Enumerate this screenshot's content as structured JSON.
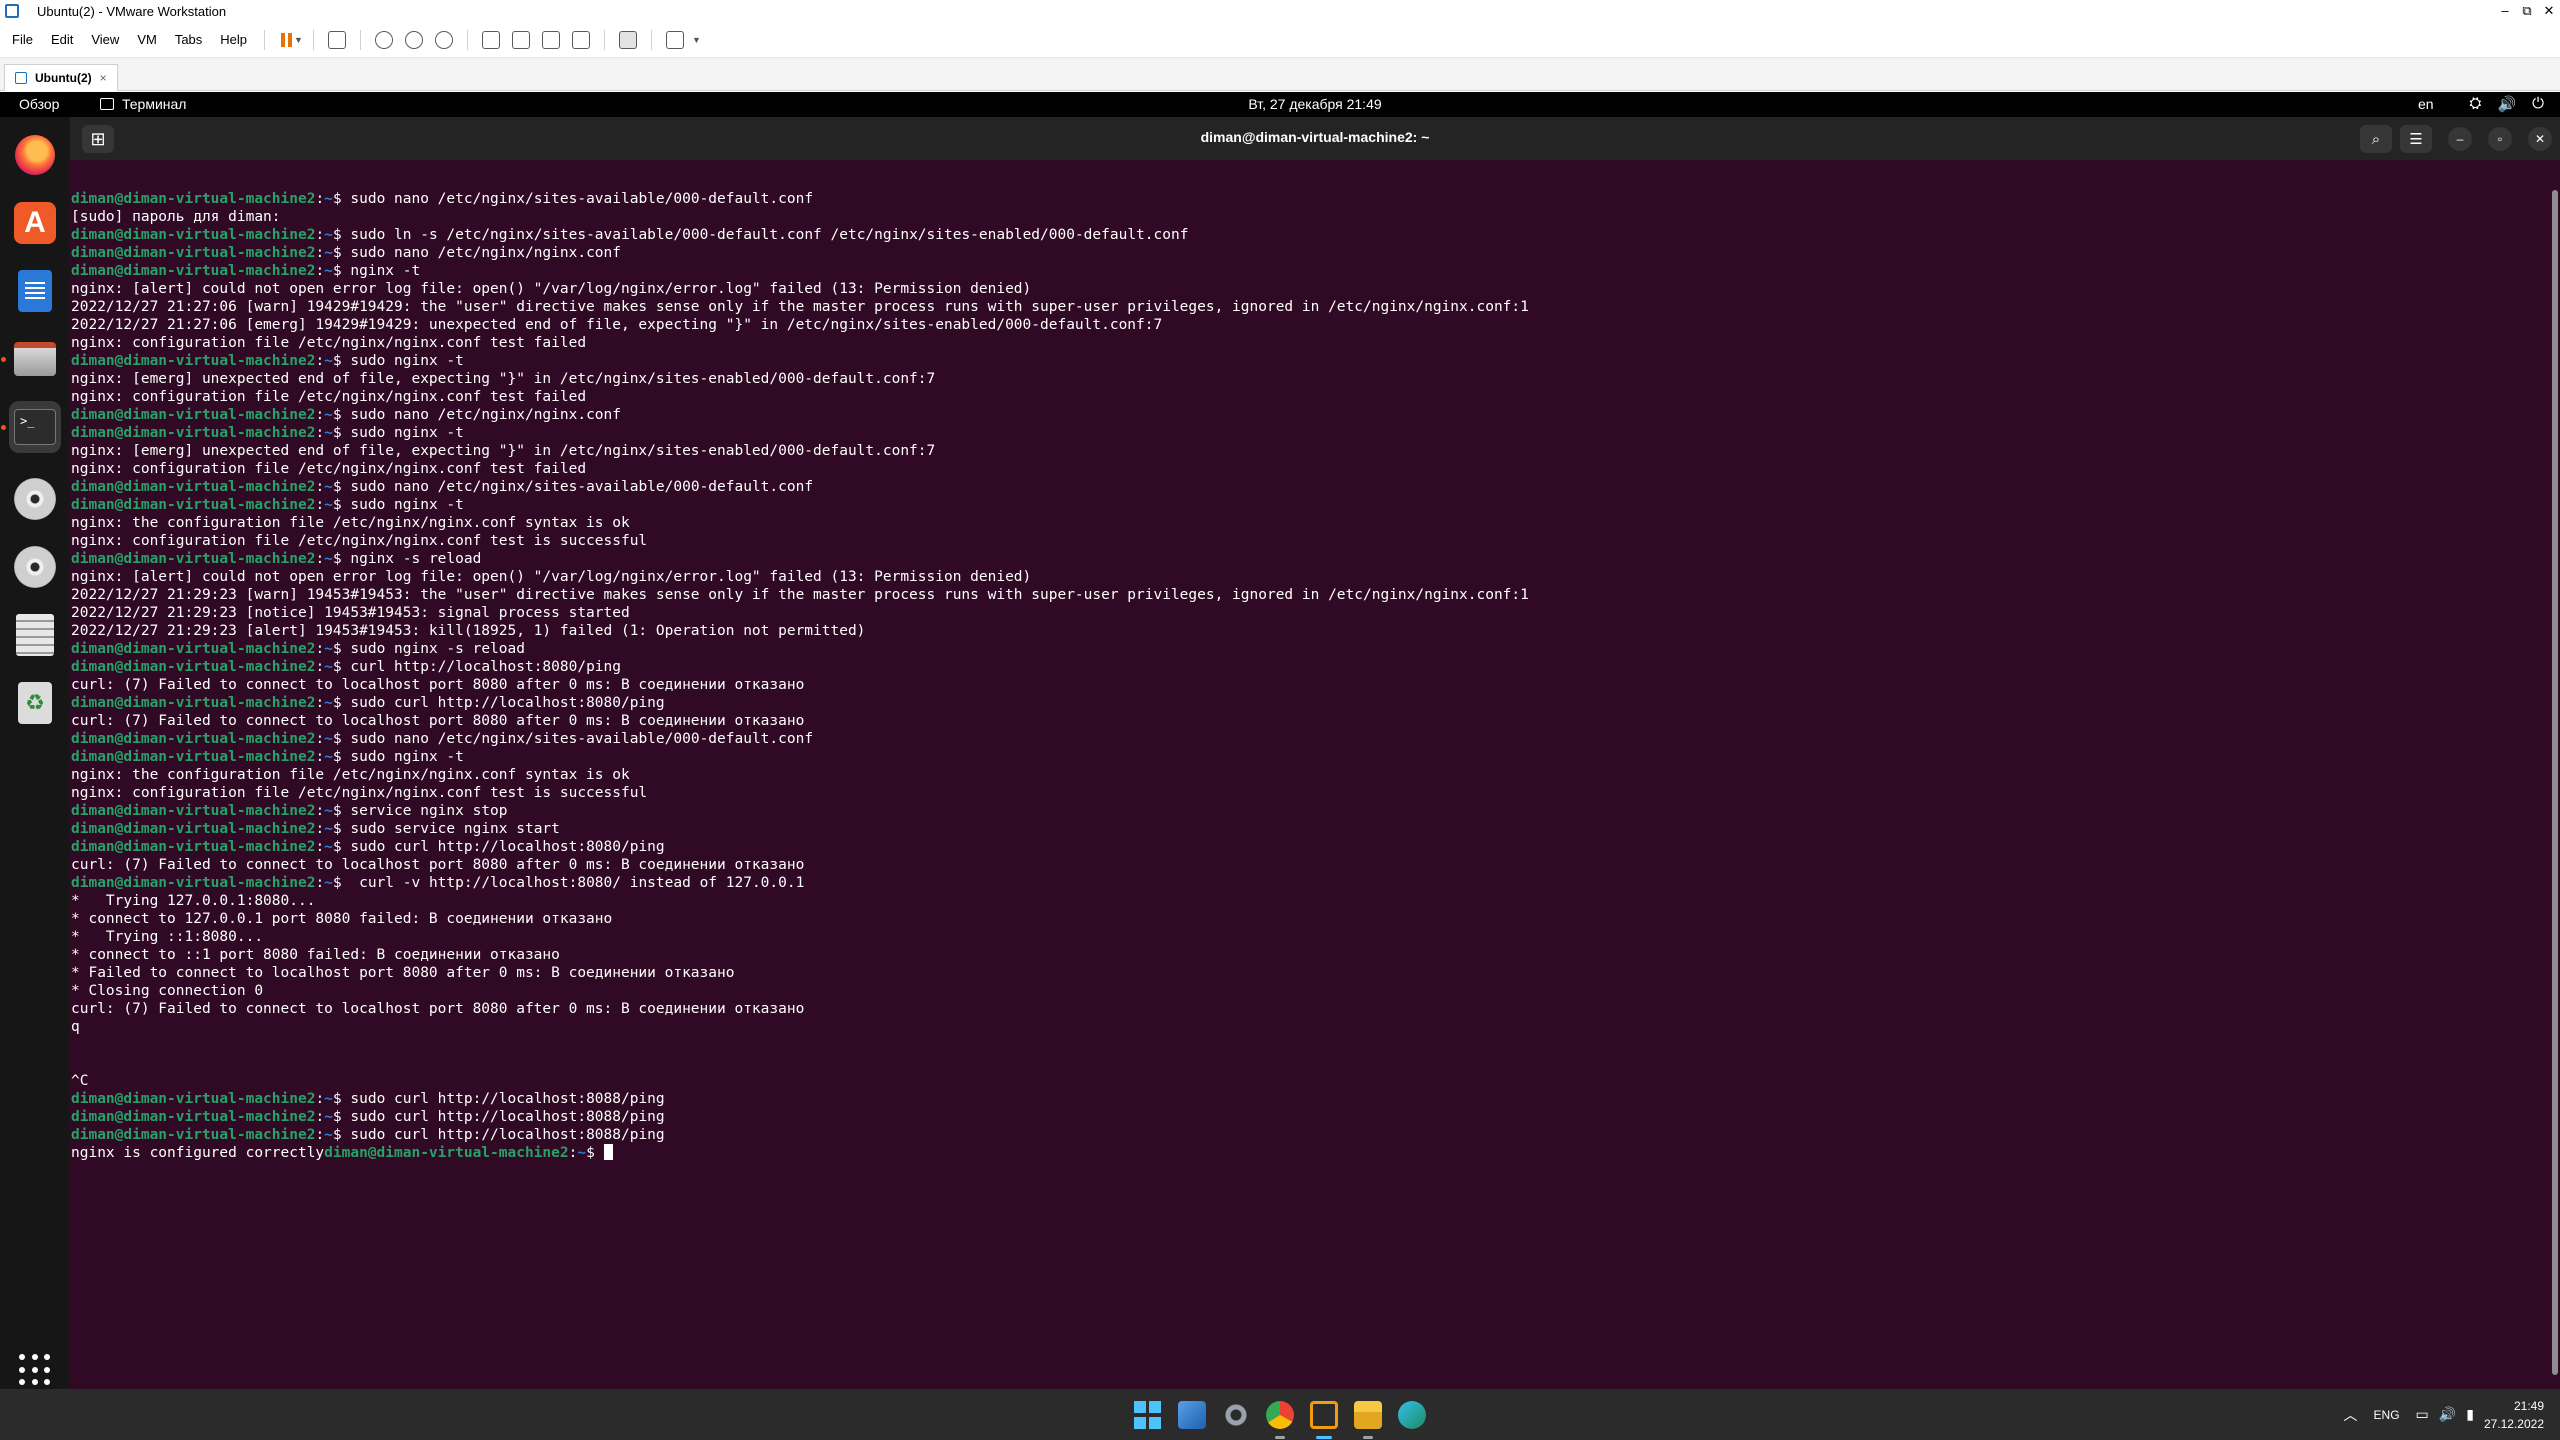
{
  "vmware": {
    "title": "Ubuntu(2) - VMware Workstation",
    "menu": [
      "File",
      "Edit",
      "View",
      "VM",
      "Tabs",
      "Help"
    ],
    "window_controls": [
      "–",
      "⧉",
      "✕"
    ],
    "tab": {
      "label": "Ubuntu(2)",
      "close": "×"
    }
  },
  "gnome": {
    "activities": "Обзор",
    "app_name": "Терминал",
    "clock": "Вт, 27 декабря  21:49",
    "lang": "en",
    "tray_icons": [
      "network-icon",
      "volume-icon",
      "power-icon"
    ]
  },
  "dock": {
    "items": [
      {
        "name": "firefox-icon"
      },
      {
        "name": "app-center-icon",
        "glyph": "A"
      },
      {
        "name": "libreoffice-writer-icon"
      },
      {
        "name": "files-icon"
      },
      {
        "name": "terminal-icon",
        "glyph": ">_",
        "active": true
      },
      {
        "name": "optical-disc-icon"
      },
      {
        "name": "optical-disc-icon"
      },
      {
        "name": "floppy-drive-icon"
      },
      {
        "name": "trash-icon",
        "glyph": "♻"
      }
    ]
  },
  "terminal": {
    "title": "diman@diman-virtual-machine2: ~",
    "prompt_user": "diman@diman-virtual-machine2",
    "prompt_path": "~",
    "lines": [
      {
        "p": true,
        "t": "sudo nano /etc/nginx/sites-available/000-default.conf"
      },
      {
        "t": "[sudo] пароль для diman:"
      },
      {
        "p": true,
        "t": "sudo ln -s /etc/nginx/sites-available/000-default.conf /etc/nginx/sites-enabled/000-default.conf"
      },
      {
        "p": true,
        "t": "sudo nano /etc/nginx/nginx.conf"
      },
      {
        "p": true,
        "t": "nginx -t"
      },
      {
        "t": "nginx: [alert] could not open error log file: open() \"/var/log/nginx/error.log\" failed (13: Permission denied)"
      },
      {
        "t": "2022/12/27 21:27:06 [warn] 19429#19429: the \"user\" directive makes sense only if the master process runs with super-user privileges, ignored in /etc/nginx/nginx.conf:1"
      },
      {
        "t": "2022/12/27 21:27:06 [emerg] 19429#19429: unexpected end of file, expecting \"}\" in /etc/nginx/sites-enabled/000-default.conf:7"
      },
      {
        "t": "nginx: configuration file /etc/nginx/nginx.conf test failed"
      },
      {
        "p": true,
        "t": "sudo nginx -t"
      },
      {
        "t": "nginx: [emerg] unexpected end of file, expecting \"}\" in /etc/nginx/sites-enabled/000-default.conf:7"
      },
      {
        "t": "nginx: configuration file /etc/nginx/nginx.conf test failed"
      },
      {
        "p": true,
        "t": "sudo nano /etc/nginx/nginx.conf"
      },
      {
        "p": true,
        "t": "sudo nginx -t"
      },
      {
        "t": "nginx: [emerg] unexpected end of file, expecting \"}\" in /etc/nginx/sites-enabled/000-default.conf:7"
      },
      {
        "t": "nginx: configuration file /etc/nginx/nginx.conf test failed"
      },
      {
        "p": true,
        "t": "sudo nano /etc/nginx/sites-available/000-default.conf"
      },
      {
        "p": true,
        "t": "sudo nginx -t"
      },
      {
        "t": "nginx: the configuration file /etc/nginx/nginx.conf syntax is ok"
      },
      {
        "t": "nginx: configuration file /etc/nginx/nginx.conf test is successful"
      },
      {
        "p": true,
        "t": "nginx -s reload"
      },
      {
        "t": "nginx: [alert] could not open error log file: open() \"/var/log/nginx/error.log\" failed (13: Permission denied)"
      },
      {
        "t": "2022/12/27 21:29:23 [warn] 19453#19453: the \"user\" directive makes sense only if the master process runs with super-user privileges, ignored in /etc/nginx/nginx.conf:1"
      },
      {
        "t": "2022/12/27 21:29:23 [notice] 19453#19453: signal process started"
      },
      {
        "t": "2022/12/27 21:29:23 [alert] 19453#19453: kill(18925, 1) failed (1: Operation not permitted)"
      },
      {
        "p": true,
        "t": "sudo nginx -s reload"
      },
      {
        "p": true,
        "t": "curl http://localhost:8080/ping"
      },
      {
        "t": "curl: (7) Failed to connect to localhost port 8080 after 0 ms: В соединении отказано"
      },
      {
        "p": true,
        "t": "sudo curl http://localhost:8080/ping"
      },
      {
        "t": "curl: (7) Failed to connect to localhost port 8080 after 0 ms: В соединении отказано"
      },
      {
        "p": true,
        "t": "sudo nano /etc/nginx/sites-available/000-default.conf"
      },
      {
        "p": true,
        "t": "sudo nginx -t"
      },
      {
        "t": "nginx: the configuration file /etc/nginx/nginx.conf syntax is ok"
      },
      {
        "t": "nginx: configuration file /etc/nginx/nginx.conf test is successful"
      },
      {
        "p": true,
        "t": "service nginx stop"
      },
      {
        "p": true,
        "t": "sudo service nginx start"
      },
      {
        "p": true,
        "t": "sudo curl http://localhost:8080/ping"
      },
      {
        "t": "curl: (7) Failed to connect to localhost port 8080 after 0 ms: В соединении отказано"
      },
      {
        "p": true,
        "t": " curl -v http://localhost:8080/ instead of 127.0.0.1"
      },
      {
        "t": "*   Trying 127.0.0.1:8080..."
      },
      {
        "t": "* connect to 127.0.0.1 port 8080 failed: В соединении отказано"
      },
      {
        "t": "*   Trying ::1:8080..."
      },
      {
        "t": "* connect to ::1 port 8080 failed: В соединении отказано"
      },
      {
        "t": "* Failed to connect to localhost port 8080 after 0 ms: В соединении отказано"
      },
      {
        "t": "* Closing connection 0"
      },
      {
        "t": "curl: (7) Failed to connect to localhost port 8080 after 0 ms: В соединении отказано"
      },
      {
        "t": "q"
      },
      {
        "t": ""
      },
      {
        "t": ""
      },
      {
        "t": "^C"
      },
      {
        "p": true,
        "t": "sudo curl http://localhost:8088/ping"
      },
      {
        "p": true,
        "t": "sudo curl http://localhost:8088/ping"
      },
      {
        "p": true,
        "t": "sudo curl http://localhost:8088/ping"
      },
      {
        "pre": "nginx is configured correctly",
        "p": true,
        "t": "",
        "cursor": true
      }
    ]
  },
  "taskbar": {
    "apps": [
      "windows-start-icon",
      "photos-icon",
      "settings-icon",
      "chrome-icon",
      "vmware-icon",
      "file-explorer-icon",
      "edge-icon"
    ],
    "lang": "ENG",
    "time": "21:49",
    "date": "27.12.2022"
  },
  "colors": {
    "terminal_bg": "#300a24",
    "prompt_user": "#26a269",
    "prompt_path": "#2a7bde",
    "ubuntu_orange": "#e95420"
  }
}
